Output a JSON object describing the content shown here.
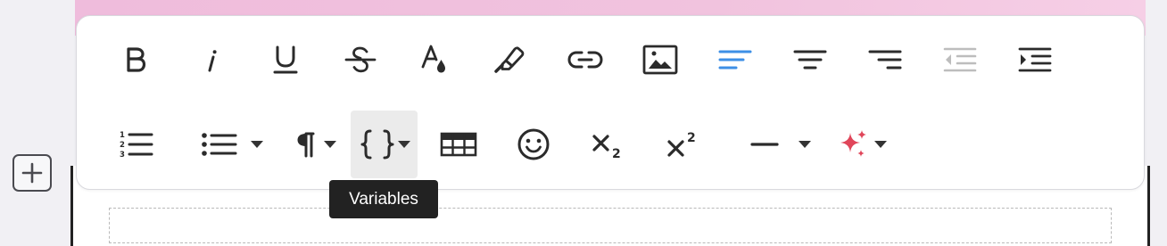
{
  "tooltip": {
    "text": "Variables"
  },
  "toolbar": {
    "row1": [
      "bold",
      "italic",
      "underline",
      "strikethrough",
      "text-color",
      "highlight",
      "link",
      "image",
      "align-left",
      "align-center",
      "align-right",
      "outdent",
      "indent"
    ],
    "row2": [
      "ordered-list",
      "bullet-list",
      "paragraph-format",
      "variables",
      "table",
      "emoji",
      "subscript",
      "superscript",
      "horizontal-rule",
      "ai-assist"
    ],
    "active": "variables",
    "disabled": [
      "outdent"
    ]
  },
  "colors": {
    "icon": "#2b2b2b",
    "accent_blue": "#3d8fe6",
    "sparkle_red": "#e0465a",
    "disabled": "#bdbdbd",
    "active_bg": "#ebebeb",
    "tooltip_bg": "#222222"
  }
}
